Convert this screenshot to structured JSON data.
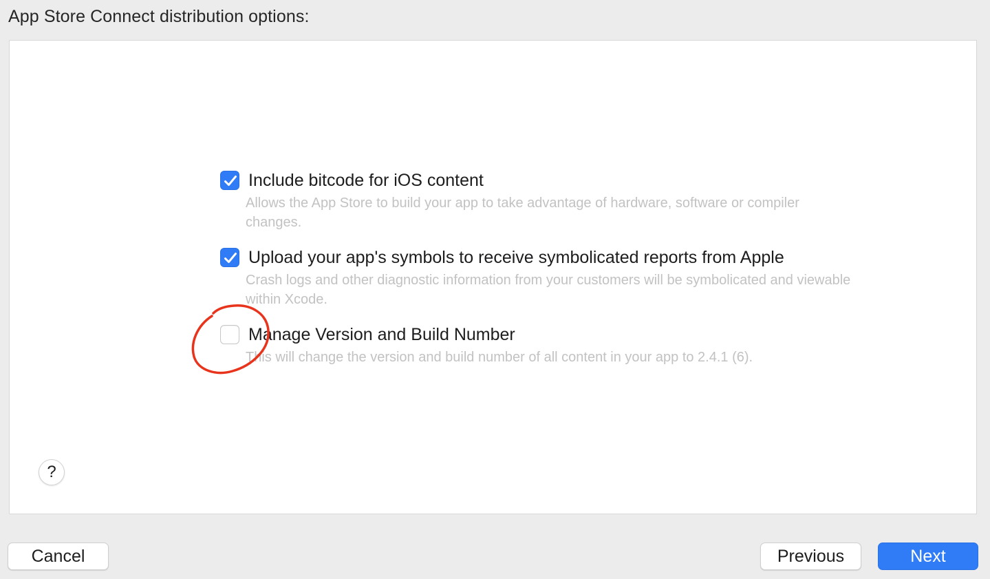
{
  "header": {
    "title": "App Store Connect distribution options:"
  },
  "options": [
    {
      "label": "Include bitcode for iOS content",
      "description": "Allows the App Store to build your app to take advantage of hardware, software or compiler changes.",
      "checked": true
    },
    {
      "label": "Upload your app's symbols to receive symbolicated reports from Apple",
      "description": "Crash logs and other diagnostic information from your customers will be symbolicated and viewable within Xcode.",
      "checked": true
    },
    {
      "label": "Manage Version and Build Number",
      "description": "This will change the version and build number of all content in your app to 2.4.1 (6).",
      "checked": false
    }
  ],
  "help": {
    "label": "?"
  },
  "footer": {
    "cancel_label": "Cancel",
    "previous_label": "Previous",
    "next_label": "Next"
  },
  "colors": {
    "accent": "#2f7cf6",
    "annotation": "#e8341c",
    "window_background": "#ececec",
    "panel_background": "#ffffff",
    "description_text": "#c2c2c2"
  }
}
